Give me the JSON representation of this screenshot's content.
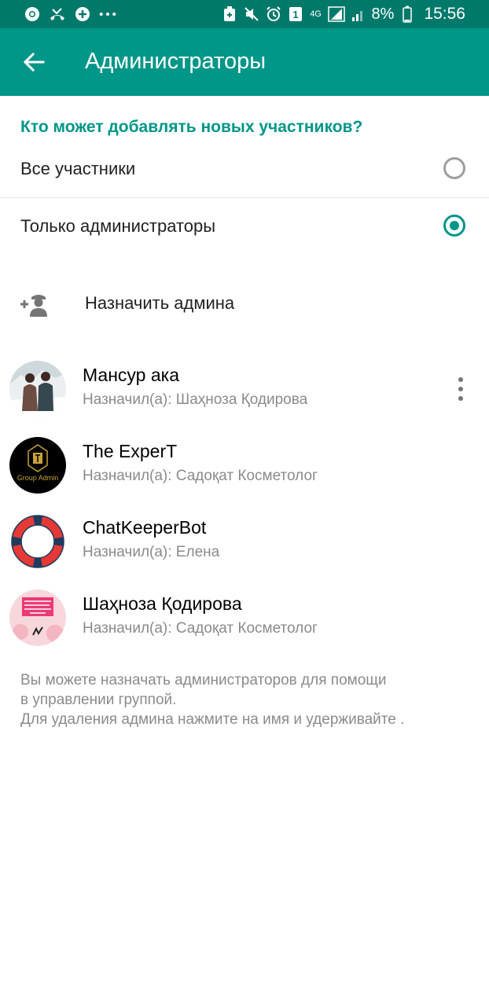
{
  "status_bar": {
    "network": "4G",
    "battery": "8%",
    "time": "15:56",
    "icons_left": [
      "chrome-icon",
      "missed-call-icon",
      "add-icon",
      "more-icon"
    ],
    "icons_right": [
      "battery-saver-icon",
      "mute-icon",
      "alarm-icon",
      "sim-1-icon",
      "signal-icon",
      "signal-icon",
      "battery-icon"
    ]
  },
  "app_bar": {
    "title": "Администраторы",
    "back_icon": "arrow-left-icon"
  },
  "add_members": {
    "question": "Кто может добавлять новых участников?",
    "options": [
      {
        "label": "Все участники",
        "selected": false
      },
      {
        "label": "Только администраторы",
        "selected": true
      }
    ]
  },
  "assign_admin": {
    "label": "Назначить админа",
    "icon": "add-admin-icon"
  },
  "admins": [
    {
      "name": "Мансур ака",
      "subtitle": "Назначил(а): Шаҳноза Қодирова",
      "has_menu": true
    },
    {
      "name": "The ExperT",
      "subtitle": "Назначил(а): Садоқат Косметолог",
      "avatar_text": "Group Admin"
    },
    {
      "name": "ChatKeeperBot",
      "subtitle": "Назначил(а): Елена"
    },
    {
      "name": "Шаҳноза Қодирова",
      "subtitle": "Назначил(а): Садоқат Косметолог"
    }
  ],
  "footer": {
    "line1": "Вы можете назначать администраторов для помощи",
    "line2": "в управлении группой.",
    "line3": "Для удаления админа нажмите на имя и удерживайте ."
  },
  "colors": {
    "status_bar": "#00796b",
    "app_bar": "#009688",
    "accent": "#009688"
  }
}
